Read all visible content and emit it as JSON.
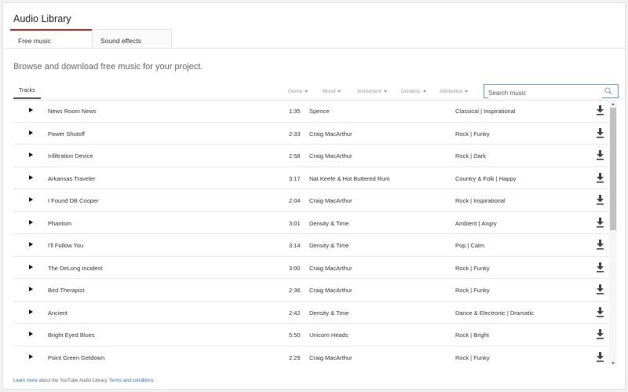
{
  "app": {
    "title": "Audio Library"
  },
  "tabs": [
    {
      "label": "Free music",
      "active": true
    },
    {
      "label": "Sound effects",
      "active": false
    }
  ],
  "subtitle": "Browse and download free music for your project.",
  "filters": {
    "tracks_label": "Tracks",
    "items": [
      "Genre",
      "Mood",
      "Instrument",
      "Duration",
      "Attribution"
    ]
  },
  "search": {
    "placeholder": "Search music",
    "value": ""
  },
  "tracks": [
    {
      "title": "News Room News",
      "duration": "1:35",
      "artist": "Spence",
      "genre": "Classical | Inspirational"
    },
    {
      "title": "Power Shutoff",
      "duration": "2:33",
      "artist": "Craig MacArthur",
      "genre": "Rock | Funky"
    },
    {
      "title": "Infiltration Device",
      "duration": "2:58",
      "artist": "Craig MacArthur",
      "genre": "Rock | Dark"
    },
    {
      "title": "Arkansas Traveler",
      "duration": "3:17",
      "artist": "Nat Keefe & Hot Buttered Rum",
      "genre": "Country & Folk | Happy"
    },
    {
      "title": "I Found DB Cooper",
      "duration": "2:04",
      "artist": "Craig MacArthur",
      "genre": "Rock | Inspirational"
    },
    {
      "title": "Phantom",
      "duration": "3:01",
      "artist": "Density & Time",
      "genre": "Ambient | Angry"
    },
    {
      "title": "I'll Follow You",
      "duration": "3:14",
      "artist": "Density & Time",
      "genre": "Pop | Calm"
    },
    {
      "title": "The DeLong Incident",
      "duration": "3:00",
      "artist": "Craig MacArthur",
      "genre": "Rock | Funky"
    },
    {
      "title": "Bird Therapist",
      "duration": "2:36",
      "artist": "Craig MacArthur",
      "genre": "Rock | Funky"
    },
    {
      "title": "Ancient",
      "duration": "2:42",
      "artist": "Density & Time",
      "genre": "Dance & Electronic | Dramatic"
    },
    {
      "title": "Bright Eyed Blues",
      "duration": "5:50",
      "artist": "Unicorn Heads",
      "genre": "Rock | Bright"
    },
    {
      "title": "Point Green Getdown",
      "duration": "2:29",
      "artist": "Craig MacArthur",
      "genre": "Rock | Funky"
    }
  ],
  "footer": {
    "learn_more": "Learn more",
    "middle": "about the YouTube Audio Library.",
    "terms": "Terms and conditions"
  },
  "colors": {
    "accent": "#cc181e",
    "link": "#2f6db8",
    "search_border": "#5aa0d6"
  },
  "icons": {
    "play": "play-icon",
    "download": "download-icon",
    "search": "search-icon",
    "caret": "caret-down-icon"
  }
}
